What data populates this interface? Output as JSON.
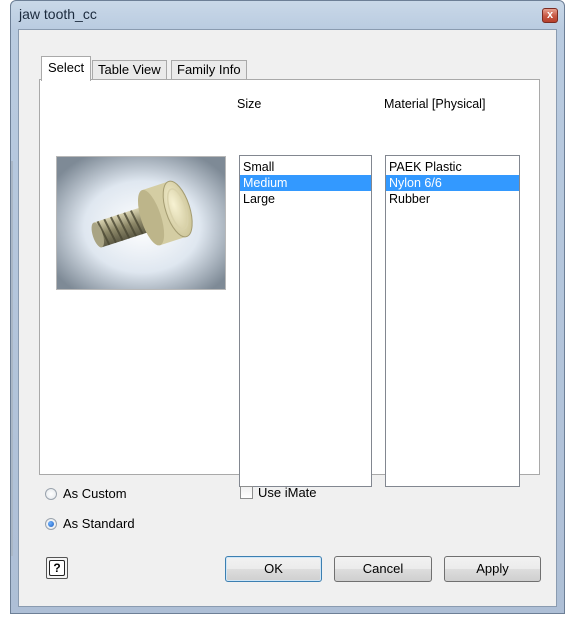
{
  "window": {
    "title": "jaw tooth_cc",
    "close_glyph": "x",
    "close_icon": "close-icon"
  },
  "tabs": [
    {
      "label": "Select",
      "active": true
    },
    {
      "label": "Table View",
      "active": false
    },
    {
      "label": "Family Info",
      "active": false
    }
  ],
  "select_tab": {
    "size": {
      "label": "Size",
      "items": [
        "Small",
        "Medium",
        "Large"
      ],
      "selected": "Medium"
    },
    "material": {
      "label": "Material [Physical]",
      "items": [
        "PAEK Plastic",
        "Nylon 6/6",
        "Rubber"
      ],
      "selected": "Nylon 6/6"
    }
  },
  "options": {
    "as_custom": {
      "label": "As Custom",
      "checked": false
    },
    "as_standard": {
      "label": "As Standard",
      "checked": true
    },
    "use_imate": {
      "label": "Use iMate",
      "checked": false
    }
  },
  "buttons": {
    "help": "?",
    "ok": "OK",
    "cancel": "Cancel",
    "apply": "Apply"
  },
  "colors": {
    "selection": "#3399ff",
    "default_button_border": "#3c7fb1"
  }
}
